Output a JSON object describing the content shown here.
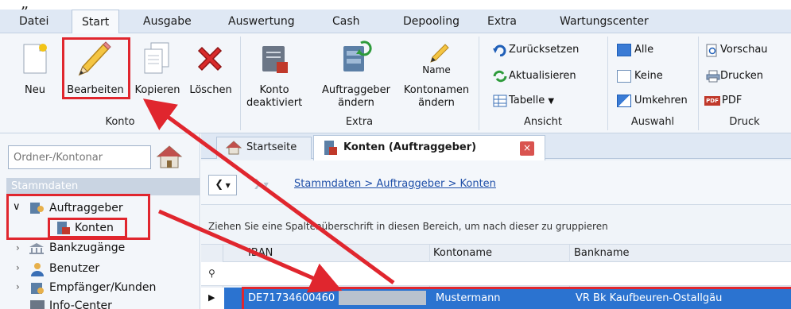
{
  "menu": {
    "tabs": [
      "Datei",
      "Start",
      "Ausgabe",
      "Auswertung",
      "Cash",
      "Depooling",
      "Extra",
      "Wartungscenter"
    ],
    "active": "Start"
  },
  "ribbon": {
    "konto": {
      "group_label": "Konto",
      "new_label": "Neu",
      "edit_label": "Bearbeiten",
      "copy_label": "Kopieren",
      "delete_label": "Löschen"
    },
    "extra": {
      "group_label": "Extra",
      "deactivate_label_1": "Konto",
      "deactivate_label_2": "deaktiviert",
      "principal_label_1": "Auftraggeber",
      "principal_label_2": "ändern",
      "name_icon_text": "Name",
      "accountname_label_1": "Kontonamen",
      "accountname_label_2": "ändern"
    },
    "ansicht": {
      "group_label": "Ansicht",
      "reset_label": "Zurücksetzen",
      "refresh_label": "Aktualisieren",
      "table_label": "Tabelle"
    },
    "auswahl": {
      "group_label": "Auswahl",
      "all_label": "Alle",
      "none_label": "Keine",
      "invert_label": "Umkehren"
    },
    "druck": {
      "group_label": "Druck",
      "preview_label": "Vorschau",
      "print_label": "Drucken",
      "pdf_label": "PDF",
      "pdf_badge": "PDF"
    }
  },
  "sidebar": {
    "search_placeholder": "Ordner-/Kontonar",
    "section_title": "Stammdaten",
    "items": [
      {
        "label": "Auftraggeber"
      },
      {
        "label": "Konten"
      },
      {
        "label": "Bankzugänge"
      },
      {
        "label": "Benutzer"
      },
      {
        "label": "Empfänger/Kunden"
      },
      {
        "label": "Info-Center"
      }
    ]
  },
  "doc_tabs": {
    "home_label": "Startseite",
    "active_label": "Konten (Auftraggeber)"
  },
  "breadcrumb": "Stammdaten > Auftraggeber > Konten",
  "group_hint": "Ziehen Sie eine Spaltenüberschrift in diesen Bereich, um nach dieser zu gruppieren",
  "grid": {
    "columns": [
      "IBAN",
      "Kontoname",
      "Bankname"
    ],
    "rows": [
      {
        "iban": "DE71734600460",
        "kontoname": "Mustermann",
        "bankname": "VR Bk Kaufbeuren-Ostallgäu"
      }
    ]
  },
  "colors": {
    "highlight": "#e0262e",
    "selection": "#2b73d0",
    "menubar": "#dfe8f4"
  }
}
